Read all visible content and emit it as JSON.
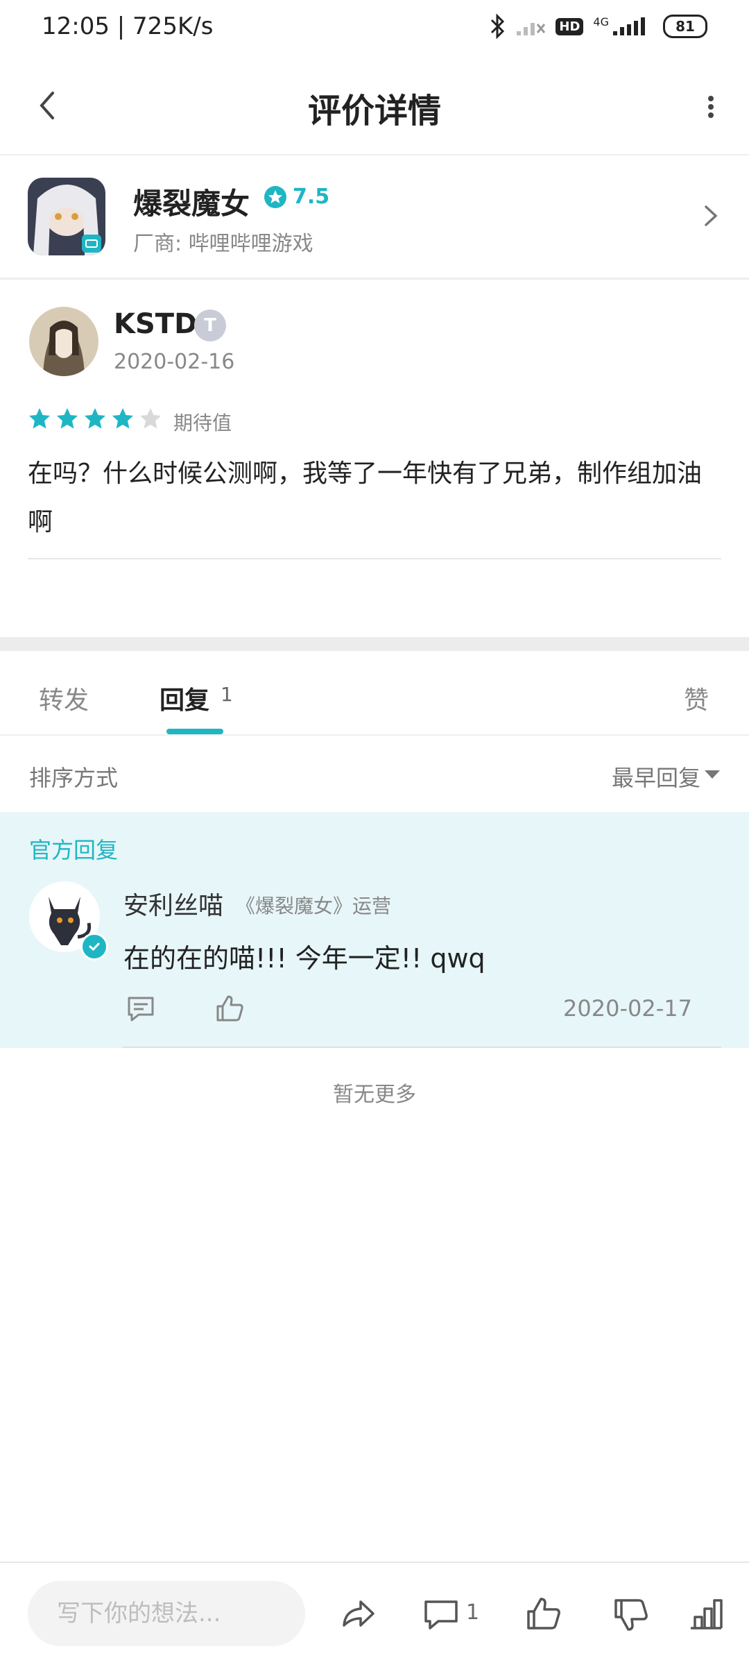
{
  "status_bar": {
    "time_speed": "12:05 | 725K/s",
    "network": "4G",
    "hd": "HD",
    "battery": "81"
  },
  "header": {
    "title": "评价详情"
  },
  "game": {
    "name": "爆裂魔女",
    "score": "7.5",
    "vendor": "厂商: 哔哩哔哩游戏"
  },
  "review": {
    "username": "KSTD",
    "badge": "T",
    "date": "2020-02-16",
    "stars": 4,
    "stars_max": 5,
    "stars_label": "期待值",
    "text": "在吗？什么时候公测啊，我等了一年快有了兄弟，制作组加油啊"
  },
  "tabs": {
    "forward": "转发",
    "reply": "回复",
    "reply_count": "1",
    "like": "赞"
  },
  "sort": {
    "label": "排序方式",
    "value": "最早回复"
  },
  "official_reply": {
    "tag": "官方回复",
    "name": "安利丝喵",
    "role": "《爆裂魔女》运营",
    "text": "在的在的喵!!! 今年一定!! qwq",
    "date": "2020-02-17"
  },
  "no_more": "暂无更多",
  "bottom_bar": {
    "placeholder": "写下你的想法...",
    "comment_count": "1"
  },
  "colors": {
    "accent": "#1fb6c4",
    "official_bg": "#e7f6f9",
    "star_empty": "#d9d9d9"
  }
}
